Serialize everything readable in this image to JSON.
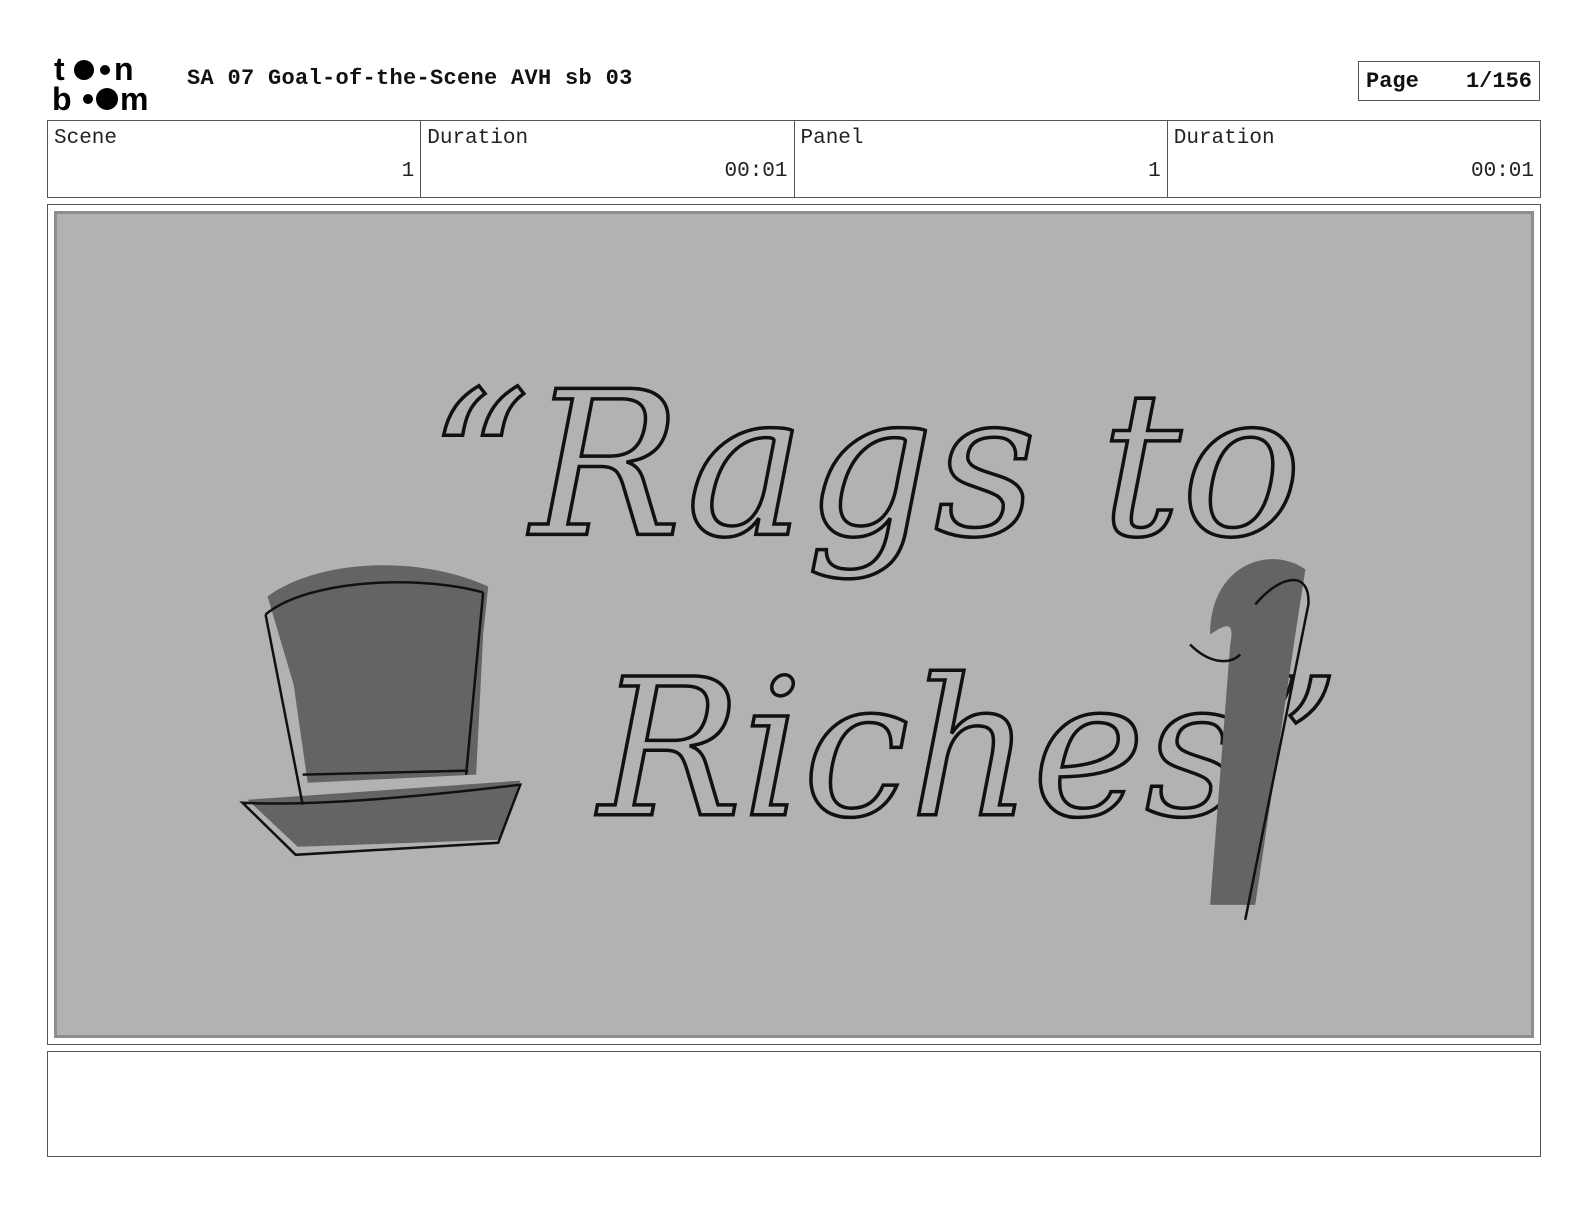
{
  "header": {
    "logo_text": "toonboom",
    "title": "SA 07 Goal-of-the-Scene AVH sb 03",
    "page_label": "Page",
    "page_value": "1/156"
  },
  "info": [
    {
      "label": "Scene",
      "value": "1"
    },
    {
      "label": "Duration",
      "value": "00:01"
    },
    {
      "label": "Panel",
      "value": "1"
    },
    {
      "label": "Duration",
      "value": "00:01"
    }
  ],
  "panel": {
    "sketch_text_line1": "“Rags to",
    "sketch_text_line2": "Riches”"
  },
  "notes": {
    "text": ""
  }
}
